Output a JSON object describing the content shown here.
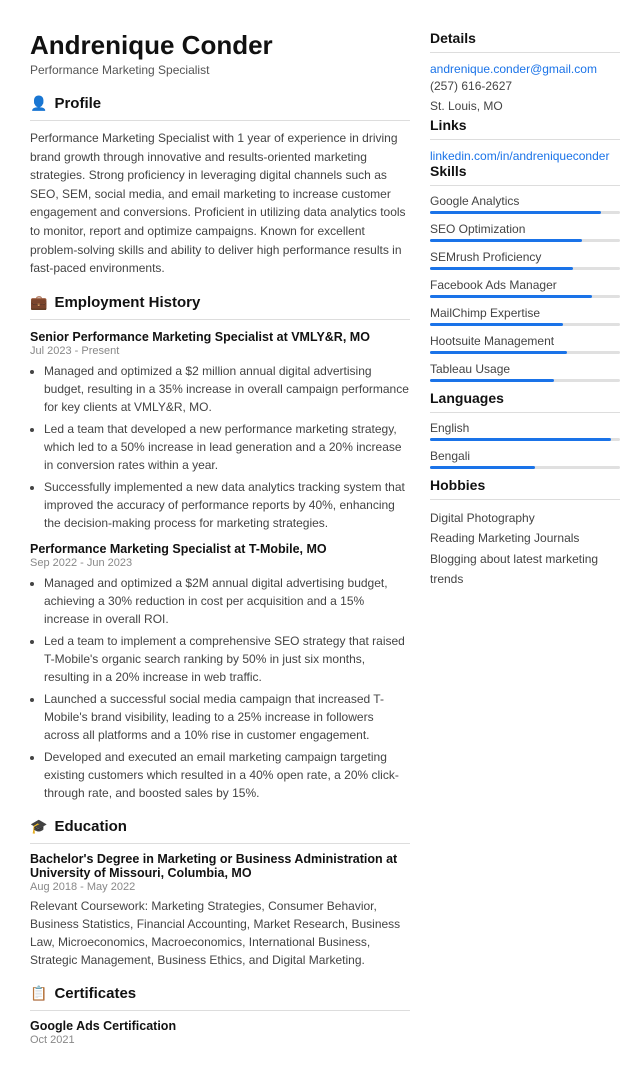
{
  "header": {
    "name": "Andrenique Conder",
    "title": "Performance Marketing Specialist"
  },
  "profile": {
    "section_label": "Profile",
    "icon": "👤",
    "text": "Performance Marketing Specialist with 1 year of experience in driving brand growth through innovative and results-oriented marketing strategies. Strong proficiency in leveraging digital channels such as SEO, SEM, social media, and email marketing to increase customer engagement and conversions. Proficient in utilizing data analytics tools to monitor, report and optimize campaigns. Known for excellent problem-solving skills and ability to deliver high performance results in fast-paced environments."
  },
  "employment": {
    "section_label": "Employment History",
    "icon": "💼",
    "jobs": [
      {
        "title": "Senior Performance Marketing Specialist at VMLY&R, MO",
        "date": "Jul 2023 - Present",
        "bullets": [
          "Managed and optimized a $2 million annual digital advertising budget, resulting in a 35% increase in overall campaign performance for key clients at VMLY&R, MO.",
          "Led a team that developed a new performance marketing strategy, which led to a 50% increase in lead generation and a 20% increase in conversion rates within a year.",
          "Successfully implemented a new data analytics tracking system that improved the accuracy of performance reports by 40%, enhancing the decision-making process for marketing strategies."
        ]
      },
      {
        "title": "Performance Marketing Specialist at T-Mobile, MO",
        "date": "Sep 2022 - Jun 2023",
        "bullets": [
          "Managed and optimized a $2M annual digital advertising budget, achieving a 30% reduction in cost per acquisition and a 15% increase in overall ROI.",
          "Led a team to implement a comprehensive SEO strategy that raised T-Mobile's organic search ranking by 50% in just six months, resulting in a 20% increase in web traffic.",
          "Launched a successful social media campaign that increased T-Mobile's brand visibility, leading to a 25% increase in followers across all platforms and a 10% rise in customer engagement.",
          "Developed and executed an email marketing campaign targeting existing customers which resulted in a 40% open rate, a 20% click-through rate, and boosted sales by 15%."
        ]
      }
    ]
  },
  "education": {
    "section_label": "Education",
    "icon": "🎓",
    "entries": [
      {
        "title": "Bachelor's Degree in Marketing or Business Administration at University of Missouri, Columbia, MO",
        "date": "Aug 2018 - May 2022",
        "text": "Relevant Coursework: Marketing Strategies, Consumer Behavior, Business Statistics, Financial Accounting, Market Research, Business Law, Microeconomics, Macroeconomics, International Business, Strategic Management, Business Ethics, and Digital Marketing."
      }
    ]
  },
  "certificates": {
    "section_label": "Certificates",
    "icon": "📋",
    "entries": [
      {
        "title": "Google Ads Certification",
        "date": "Oct 2021"
      }
    ]
  },
  "details": {
    "section_label": "Details",
    "email": "andrenique.conder@gmail.com",
    "phone": "(257) 616-2627",
    "location": "St. Louis, MO"
  },
  "links": {
    "section_label": "Links",
    "items": [
      {
        "label": "linkedin.com/in/andreniqueconder",
        "url": "#"
      }
    ]
  },
  "skills": {
    "section_label": "Skills",
    "items": [
      {
        "name": "Google Analytics",
        "fill": 90
      },
      {
        "name": "SEO Optimization",
        "fill": 80
      },
      {
        "name": "SEMrush Proficiency",
        "fill": 75
      },
      {
        "name": "Facebook Ads Manager",
        "fill": 85
      },
      {
        "name": "MailChimp Expertise",
        "fill": 70
      },
      {
        "name": "Hootsuite Management",
        "fill": 72
      },
      {
        "name": "Tableau Usage",
        "fill": 65
      }
    ]
  },
  "languages": {
    "section_label": "Languages",
    "items": [
      {
        "name": "English",
        "fill": 95
      },
      {
        "name": "Bengali",
        "fill": 55
      }
    ]
  },
  "hobbies": {
    "section_label": "Hobbies",
    "items": [
      "Digital Photography",
      "Reading Marketing Journals",
      "Blogging about latest marketing trends"
    ]
  }
}
